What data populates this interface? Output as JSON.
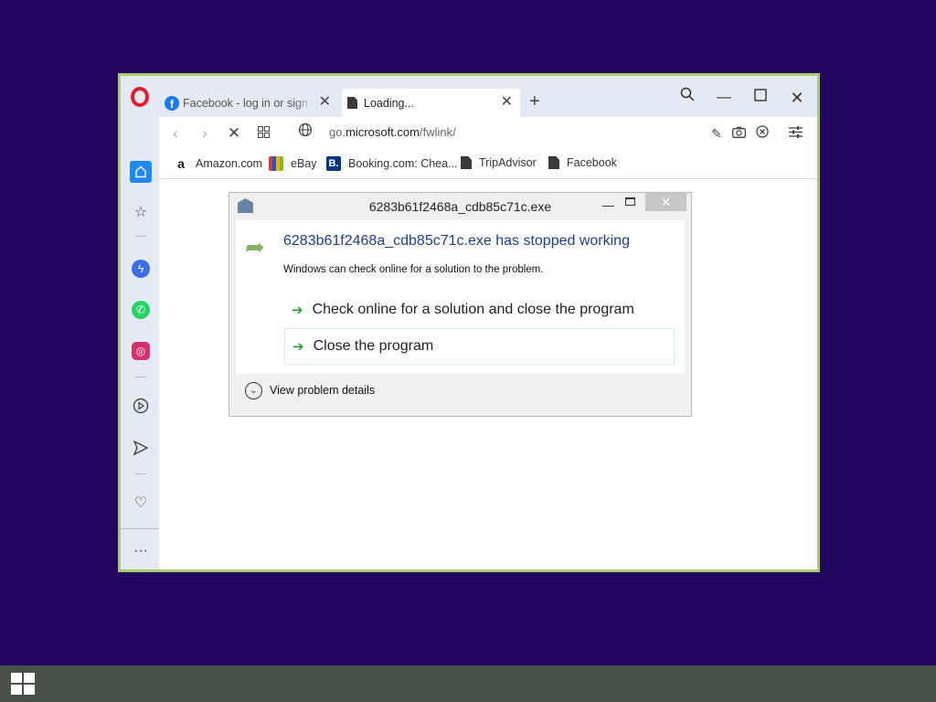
{
  "browser": {
    "tabs": [
      {
        "title": "Facebook - log in or sign up",
        "icon": "facebook-icon"
      },
      {
        "title": "Loading...",
        "icon": "page-icon",
        "active": true
      }
    ],
    "address": {
      "prefix": "go.",
      "domain": "microsoft.com",
      "path": "/fwlink/"
    },
    "bookmarks": [
      {
        "label": "Amazon.com",
        "icon": "amazon-icon"
      },
      {
        "label": "eBay",
        "icon": "ebay-icon"
      },
      {
        "label": "Booking.com: Chea...",
        "icon": "booking-icon"
      },
      {
        "label": "TripAdvisor",
        "icon": "page-icon"
      },
      {
        "label": "Facebook",
        "icon": "page-icon"
      }
    ],
    "accent_color": "#a9c96d"
  },
  "dialog": {
    "title": "6283b61f2468a_cdb85c71c.exe",
    "heading": "6283b61f2468a_cdb85c71c.exe has stopped working",
    "description": "Windows can check online for a solution to the problem.",
    "options": [
      {
        "label": "Check online for a solution and close the program"
      },
      {
        "label": "Close the program"
      }
    ],
    "details_label": "View problem details"
  },
  "colors": {
    "desktop": "#22075e",
    "taskbar": "#4a504a",
    "heading": "#1a3f8c"
  }
}
